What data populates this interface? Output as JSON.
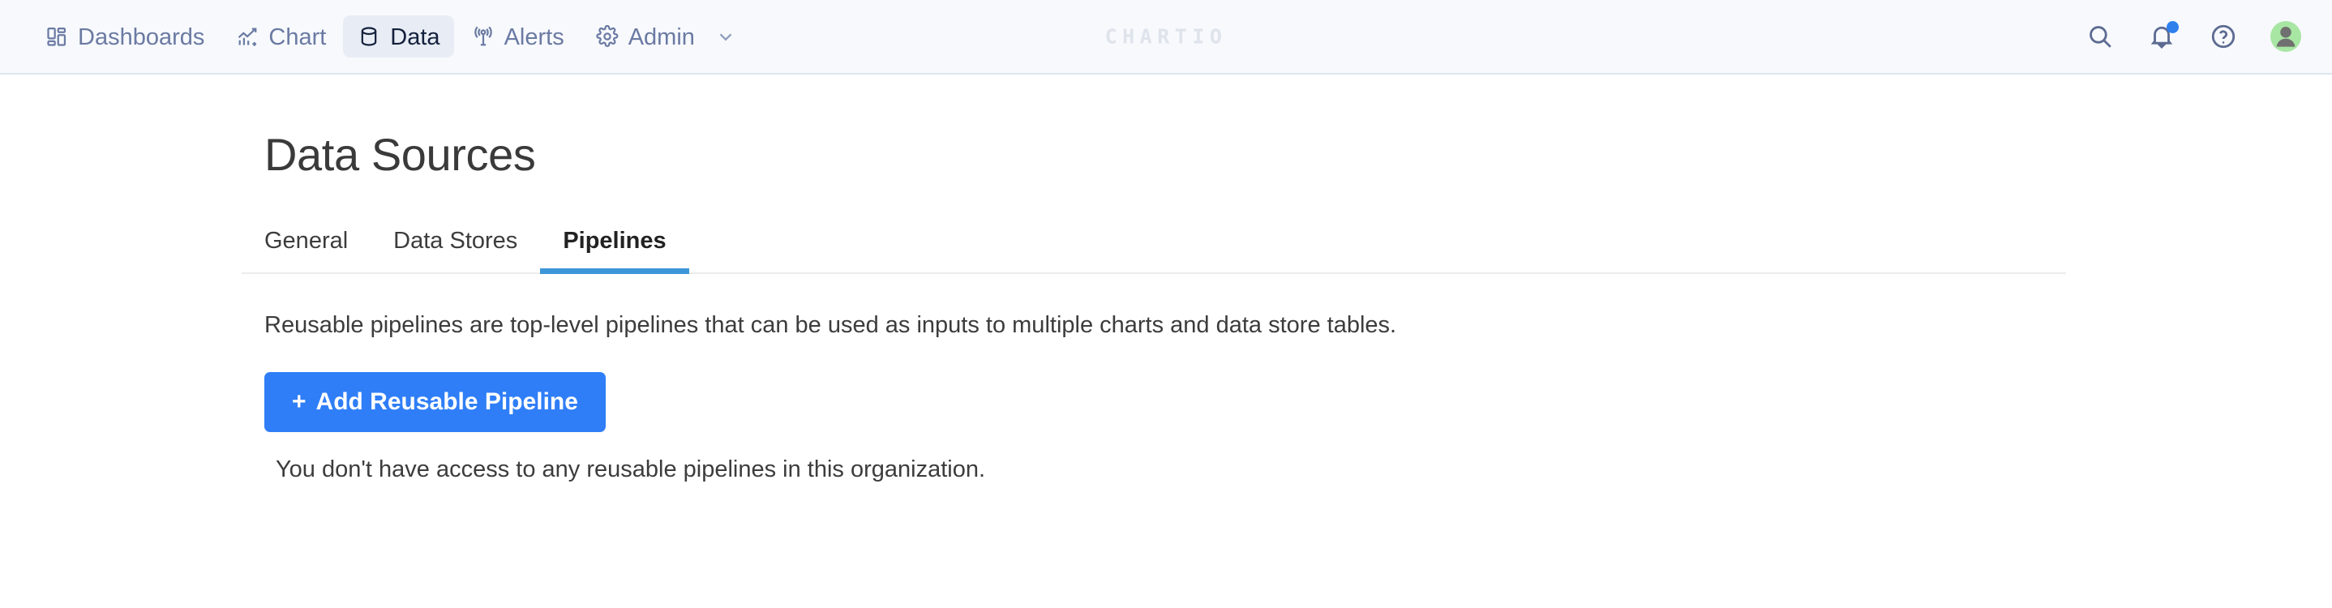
{
  "navbar": {
    "brand": "CHARTIO",
    "items": [
      {
        "label": "Dashboards",
        "icon": "dashboard-grid-icon",
        "active": false
      },
      {
        "label": "Chart",
        "icon": "chart-icon",
        "active": false
      },
      {
        "label": "Data",
        "icon": "database-icon",
        "active": true
      },
      {
        "label": "Alerts",
        "icon": "alerts-antenna-icon",
        "active": false
      },
      {
        "label": "Admin",
        "icon": "gear-icon",
        "active": false
      }
    ],
    "admin_chevron_icon": "chevron-down-icon",
    "actions": {
      "search_icon": "search-icon",
      "notifications_icon": "bell-icon",
      "notifications_badge": true,
      "help_icon": "help-circle-icon",
      "avatar_icon": "user-avatar-icon"
    },
    "colors": {
      "background": "#f7f9fc",
      "border": "#dde4f0",
      "text": "#6b7aa3",
      "active_text": "#14213d",
      "active_pill": "#e8edf5",
      "brand_text": "#dfe3eb",
      "badge": "#2f80ed",
      "avatar_background": "#a8e6a3"
    }
  },
  "page": {
    "title": "Data Sources",
    "tabs": [
      {
        "label": "General",
        "active": false
      },
      {
        "label": "Data Stores",
        "active": false
      },
      {
        "label": "Pipelines",
        "active": true
      }
    ],
    "active_tab_indicator_color": "#3d96d8",
    "description": "Reusable pipelines are top-level pipelines that can be used as inputs to multiple charts and data store tables.",
    "add_button": {
      "plus": "+",
      "label": "Add Reusable Pipeline",
      "color": "#2f7ef7"
    },
    "empty_message": "You don't have access to any reusable pipelines in this organization."
  }
}
